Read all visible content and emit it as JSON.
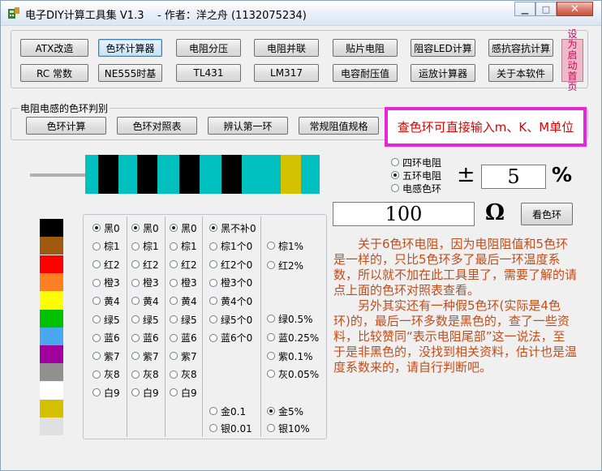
{
  "window": {
    "title": "电子DIY计算工具集 V1.3    - 作者：洋之舟 (1132075234)"
  },
  "toolbar": {
    "row1": [
      "ATX改造",
      "色环计算器",
      "电阻分压",
      "电阻并联",
      "贴片电阻",
      "阻容LED计算",
      "感抗容抗计算"
    ],
    "row2": [
      "RC 常数",
      "NE555时基",
      "TL431",
      "LM317",
      "电容耐压值",
      "运放计算器",
      "关于本软件"
    ],
    "side_label": "设为启动首页"
  },
  "resistor_group": {
    "title": "电阻电感的色环判别",
    "buttons": [
      "色环计算",
      "色环对照表",
      "辨认第一环",
      "常规阻值规格"
    ],
    "hint": "查色环可直接输入m、K、M单位"
  },
  "mode": {
    "options": [
      "四环电阻",
      "五环电阻",
      "电感色环"
    ],
    "selected": 1
  },
  "tolerance": {
    "symbol": "±",
    "value": "5",
    "unit": "%"
  },
  "result": {
    "value": "100",
    "unit": "Ω",
    "lookup_button": "看色环"
  },
  "resistor_bands": [
    "#000000",
    "#000000",
    "#000000",
    "#000000",
    "#d4c200"
  ],
  "colors": {
    "body": "#00c0c0",
    "palette": [
      "#000000",
      "#a05a10",
      "#ff0000",
      "#ff8020",
      "#ffff00",
      "#00c000",
      "#4aa8f0",
      "#a000a0",
      "#909090",
      "#ffffff",
      "#d4c000",
      "#e0e0e0"
    ]
  },
  "digit_columns": [
    {
      "items": [
        "黑0",
        "棕1",
        "红2",
        "橙3",
        "黄4",
        "绿5",
        "蓝6",
        "紫7",
        "灰8",
        "白9"
      ],
      "selected": 0
    },
    {
      "items": [
        "黑0",
        "棕1",
        "红2",
        "橙3",
        "黄4",
        "绿5",
        "蓝6",
        "紫7",
        "灰8",
        "白9"
      ],
      "selected": 0
    },
    {
      "items": [
        "黑0",
        "棕1",
        "红2",
        "橙3",
        "黄4",
        "绿5",
        "蓝6",
        "紫7",
        "灰8",
        "白9"
      ],
      "selected": 0
    }
  ],
  "multiplier_column": {
    "items": [
      "黑不补0",
      "棕1个0",
      "红2个0",
      "橙3个0",
      "黄4个0",
      "绿5个0",
      "蓝6个0",
      "金0.1",
      "银0.01"
    ],
    "selected": 0
  },
  "tolerance_column": {
    "items": [
      "棕1%",
      "红2%",
      "绿0.5%",
      "蓝0.25%",
      "紫0.1%",
      "灰0.05%",
      "金5%",
      "银10%"
    ],
    "selected": 6
  },
  "note": {
    "paragraphs": [
      "关于6色环电阻，因为电阻阻值和5色环是一样的，只比5色环多了最后一环温度系数，所以就不加在此工具里了，需要了解的请点上面的色环对照表查看。",
      "另外其实还有一种假5色环(实际是4色环)的，最后一环多数是黑色的，查了一些资料，比较赞同“表示电阻尾部”这一说法，至于是非黑色的，没找到相关资料，估计也是温度系数来的，请自行判断吧。"
    ]
  }
}
